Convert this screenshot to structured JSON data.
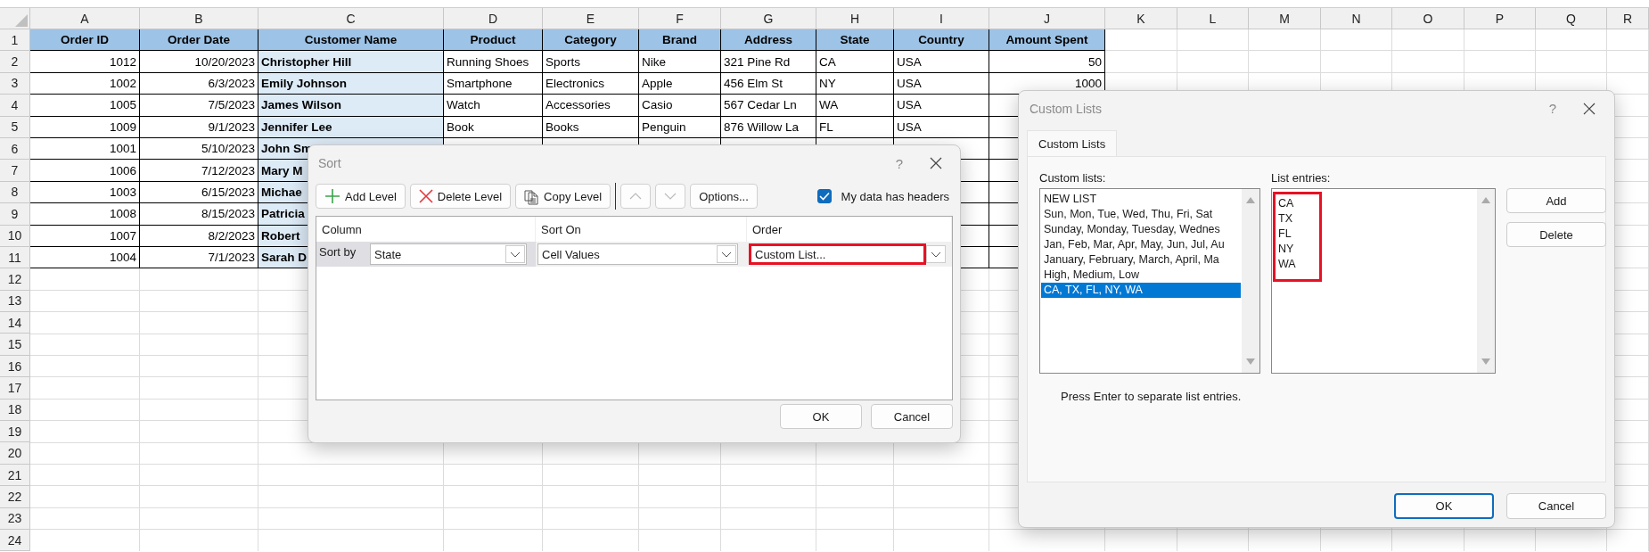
{
  "sheet": {
    "columns": [
      "A",
      "B",
      "C",
      "D",
      "E",
      "F",
      "G",
      "H",
      "I",
      "J",
      "K",
      "L",
      "M",
      "N",
      "O",
      "P",
      "Q",
      "R"
    ],
    "row_numbers": [
      "1",
      "2",
      "3",
      "4",
      "5",
      "6",
      "7",
      "8",
      "9",
      "10",
      "11",
      "12",
      "13",
      "14",
      "15",
      "16",
      "17",
      "18",
      "19",
      "20",
      "21",
      "22",
      "23",
      "24"
    ],
    "table": {
      "columns": [
        {
          "label": "Order ID",
          "numeric": true,
          "highlighted": false
        },
        {
          "label": "Order Date",
          "numeric": true,
          "highlighted": false
        },
        {
          "label": "Customer Name",
          "numeric": false,
          "highlighted": true
        },
        {
          "label": "Product",
          "numeric": false,
          "highlighted": false
        },
        {
          "label": "Category",
          "numeric": false,
          "highlighted": false
        },
        {
          "label": "Brand",
          "numeric": false,
          "highlighted": false
        },
        {
          "label": "Address",
          "numeric": false,
          "highlighted": false
        },
        {
          "label": "State",
          "numeric": false,
          "highlighted": false
        },
        {
          "label": "Country",
          "numeric": false,
          "highlighted": false
        },
        {
          "label": "Amount Spent",
          "numeric": true,
          "highlighted": false
        }
      ],
      "rows": [
        [
          "1012",
          "10/20/2023",
          "Christopher Hill",
          "Running Shoes",
          "Sports",
          "Nike",
          "321 Pine Rd",
          "CA",
          "USA",
          "50"
        ],
        [
          "1002",
          "6/3/2023",
          "Emily Johnson",
          "Smartphone",
          "Electronics",
          "Apple",
          "456 Elm St",
          "NY",
          "USA",
          "1000"
        ],
        [
          "1005",
          "7/5/2023",
          "James Wilson",
          "Watch",
          "Accessories",
          "Casio",
          "567 Cedar Ln",
          "WA",
          "USA"
        ],
        [
          "1009",
          "9/1/2023",
          "Jennifer Lee",
          "Book",
          "Books",
          "Penguin",
          "876 Willow La",
          "FL",
          "USA"
        ],
        [
          "1001",
          "5/10/2023",
          "John Sm"
        ],
        [
          "1006",
          "7/12/2023",
          "Mary M"
        ],
        [
          "1003",
          "6/15/2023",
          "Michae"
        ],
        [
          "1008",
          "8/15/2023",
          "Patricia"
        ],
        [
          "1007",
          "8/2/2023",
          "Robert"
        ],
        [
          "1004",
          "7/1/2023",
          "Sarah D"
        ]
      ]
    }
  },
  "sort_dialog": {
    "title": "Sort",
    "help": "?",
    "toolbar": [
      {
        "kind": "add",
        "label": "Add Level",
        "disabled": false
      },
      {
        "kind": "delete",
        "label": "Delete Level",
        "disabled": false
      },
      {
        "kind": "copy",
        "label": "Copy Level",
        "disabled": false
      },
      {
        "kind": "up",
        "disabled": true
      },
      {
        "kind": "down",
        "disabled": true
      },
      {
        "kind": "text",
        "label": "Options...",
        "disabled": false
      }
    ],
    "has_headers": {
      "label": "My data has headers",
      "checked": true
    },
    "columns": [
      "Column",
      "Sort On",
      "Order"
    ],
    "level": {
      "label": "Sort by",
      "column": "State",
      "sort_on": "Cell Values",
      "order": "Custom List...",
      "order_highlighted": true
    },
    "buttons": [
      "OK",
      "Cancel"
    ]
  },
  "custom_lists_dialog": {
    "title": "Custom Lists",
    "help": "?",
    "tabs": [
      {
        "label": "Custom Lists",
        "selected": true
      }
    ],
    "lists_label": "Custom lists:",
    "lists": [
      {
        "label": "NEW LIST",
        "selected": false
      },
      {
        "label": "Sun, Mon, Tue, Wed, Thu, Fri, Sat",
        "selected": false
      },
      {
        "label": "Sunday, Monday, Tuesday, Wednes",
        "selected": false
      },
      {
        "label": "Jan, Feb, Mar, Apr, May, Jun, Jul, Au",
        "selected": false
      },
      {
        "label": "January, February, March, April, Ma",
        "selected": false
      },
      {
        "label": "High, Medium, Low",
        "selected": false
      },
      {
        "label": "CA, TX, FL, NY, WA",
        "selected": true
      }
    ],
    "entries_label": "List entries:",
    "entries": [
      "CA",
      "TX",
      "FL",
      "NY",
      "WA"
    ],
    "entries_highlighted": true,
    "side_buttons": [
      "Add",
      "Delete"
    ],
    "note": "Press Enter to separate list entries.",
    "buttons": [
      {
        "label": "OK",
        "default": true
      },
      {
        "label": "Cancel",
        "default": false
      }
    ]
  }
}
